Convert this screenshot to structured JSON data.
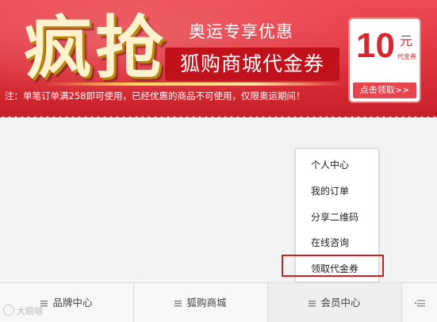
{
  "banner": {
    "big_title": "疯抢",
    "subtitle": "奥运专享优惠",
    "coupon_name": "狐购商城代金券",
    "notice": "注：单笔订单满258即可使用，已经优惠的商品不可使用，仅限奥运期间！",
    "voucher": {
      "amount": "10",
      "unit": "元",
      "sub": "代金券",
      "button": "点击领取>>"
    }
  },
  "popup_menu": {
    "items": [
      "个人中心",
      "我的订单",
      "分享二维码",
      "在线咨询",
      "领取代金券"
    ],
    "highlighted_item": "领取代金券",
    "highlight_color": "#d21e1e"
  },
  "bottom_nav": {
    "items": [
      "品牌中心",
      "狐购商城",
      "会员中心"
    ],
    "active": "会员中心"
  },
  "watermark": "大眼唱"
}
